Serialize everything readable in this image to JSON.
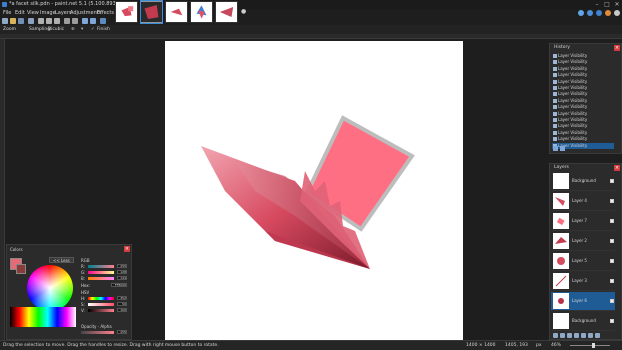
{
  "window": {
    "title": "*a facet silk.pdn - paint.net 5.1 (5.100.8930.31802)",
    "minimize": "–",
    "maximize": "□",
    "close": "✕"
  },
  "menu": [
    "File",
    "Edit",
    "View",
    "Image",
    "Layers",
    "Adjustments",
    "Effects"
  ],
  "options": {
    "tool": "Zoom",
    "sampling_label": "Sampling:",
    "sampling_value": "Bicubic",
    "finish": "Finish"
  },
  "history": {
    "title": "History",
    "items": [
      "Layer Visibility",
      "Layer Visibility",
      "Layer Visibility",
      "Layer Visibility",
      "Layer Visibility",
      "Layer Visibility",
      "Layer Visibility",
      "Layer Visibility",
      "Layer Visibility",
      "Layer Visibility",
      "Layer Visibility",
      "Layer Visibility",
      "Layer Visibility",
      "Layer Visibility",
      "Layer Visibility"
    ],
    "selected_index": 14
  },
  "layers": {
    "title": "Layers",
    "items": [
      {
        "name": "Background",
        "selected": false
      },
      {
        "name": "Layer 4",
        "selected": false
      },
      {
        "name": "Layer 7",
        "selected": false
      },
      {
        "name": "Layer 2",
        "selected": false
      },
      {
        "name": "Layer 5",
        "selected": false
      },
      {
        "name": "Layer 3",
        "selected": false
      },
      {
        "name": "Layer 6",
        "selected": true
      },
      {
        "name": "Background",
        "selected": false
      }
    ]
  },
  "colors": {
    "title": "Colors",
    "less_btn": "<< Less",
    "rgb_label": "RGB",
    "r_label": "R:",
    "r_value": "255",
    "g_label": "G:",
    "g_value": "128",
    "b_label": "B:",
    "b_value": "144",
    "hex_label": "Hex:",
    "hex_value": "FF8090",
    "hsv_label": "HSV",
    "h_label": "H:",
    "h_value": "352",
    "s_label": "S:",
    "s_value": "50",
    "v_label": "V:",
    "v_value": "100",
    "opacity_label": "Opacity - Alpha",
    "alpha_value": "255",
    "primary_color": "#e46a78",
    "secondary_color": "#8a3a3a"
  },
  "status": {
    "hint": "Drag the selection to move. Drag the handles to resize. Drag with right mouse button to rotate.",
    "size": "1400 × 1400",
    "position": "1405, 193",
    "unit": "px",
    "zoom": "46%"
  }
}
